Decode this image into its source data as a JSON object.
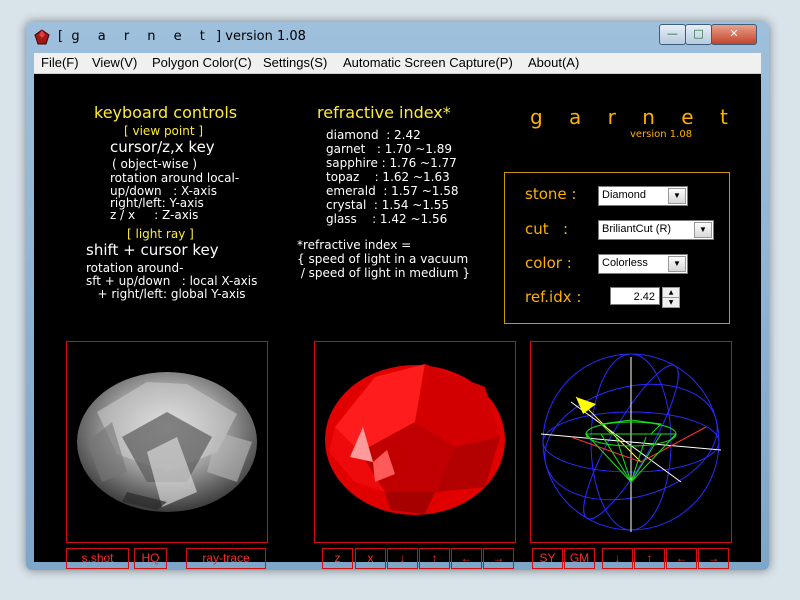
{
  "window": {
    "title_prefix": "[",
    "title_name": "g a r n e t",
    "title_suffix": "]",
    "title_version": "version 1.08",
    "min": "—",
    "max": "□",
    "close": "✕"
  },
  "menu": [
    "File(F)",
    "View(V)",
    "Polygon Color(C)",
    "Settings(S)",
    "Automatic Screen Capture(P)",
    "About(A)"
  ],
  "keyboard": {
    "heading": "keyboard controls",
    "view_point": "[ view point ]",
    "key1": "cursor/z,x key",
    "object_wise": "( object-wise )",
    "line1": "rotation around local-",
    "line2": "up/down   : X-axis",
    "line3": "right/left: Y-axis",
    "line4": "z / x     : Z-axis",
    "light_ray": "[ light ray ]",
    "key2": "shift + cursor key",
    "line5": "rotation around-",
    "line6": "sft + up/down   : local X-axis",
    "line7": "   + right/left: global Y-axis"
  },
  "refractive": {
    "heading": "refractive index*",
    "rows": [
      "diamond  : 2.42",
      "garnet   : 1.70 ~1.89",
      "sapphire : 1.76 ~1.77",
      "topaz    : 1.62 ~1.63",
      "emerald  : 1.57 ~1.58",
      "crystal  : 1.54 ~1.55",
      "glass    : 1.42 ~1.56"
    ],
    "note1": "*refractive index =",
    "note2": "{ speed of light in a vacuum",
    "note3": " / speed of light in medium }"
  },
  "brand": {
    "name": "g a r n e t",
    "version": "version 1.08"
  },
  "controls": {
    "stone_label": "stone :",
    "stone_value": "Diamond",
    "cut_label": "cut   :",
    "cut_value": "BriliantCut (R)",
    "color_label": "color :",
    "color_value": "Colorless",
    "refidx_label": "ref.idx :",
    "refidx_value": "2.42"
  },
  "buttons": {
    "sshot": "s.shot",
    "hq": "HQ",
    "raytrace": "ray-trace",
    "z": "z",
    "x": "x",
    "down": "↓",
    "up": "↑",
    "left": "←",
    "right": "→",
    "sy": "SY",
    "gm": "GM"
  },
  "colors": {
    "text_yellow": "#ffea3a",
    "accent_orange": "#ffb000",
    "panel_border": "#d01010",
    "button_text": "#ff2a2a"
  },
  "icons": [
    "app-gem-icon",
    "combo-arrow-icon",
    "spin-up-icon",
    "spin-down-icon"
  ]
}
